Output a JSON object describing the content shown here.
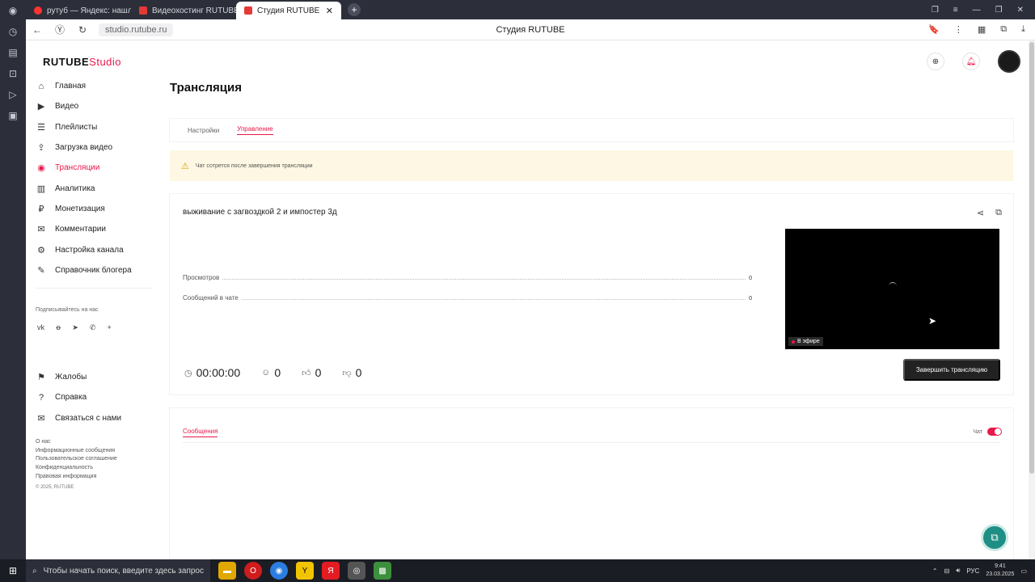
{
  "browser": {
    "tabs": [
      {
        "label": "рутуб — Яндекс: нашлось"
      },
      {
        "label": "Видеохостинг RUTUBE. С"
      },
      {
        "label": "Студия RUTUBE",
        "active": true
      }
    ],
    "url": "studio.rutube.ru",
    "page_title": "Студия RUTUBE"
  },
  "brand": {
    "name": "RUTUBE",
    "suffix": "Studio",
    "accent": "#e8184a"
  },
  "sidebar": {
    "items": [
      {
        "label": "Главная",
        "icon": "home-icon"
      },
      {
        "label": "Видео",
        "icon": "video-icon"
      },
      {
        "label": "Плейлисты",
        "icon": "playlist-icon"
      },
      {
        "label": "Загрузка видео",
        "icon": "upload-icon"
      },
      {
        "label": "Трансляции",
        "icon": "broadcast-icon",
        "active": true
      },
      {
        "label": "Аналитика",
        "icon": "analytics-icon"
      },
      {
        "label": "Монетизация",
        "icon": "monetization-icon"
      },
      {
        "label": "Комментарии",
        "icon": "comments-icon"
      },
      {
        "label": "Настройка канала",
        "icon": "gear-icon"
      },
      {
        "label": "Справочник блогера",
        "icon": "book-icon"
      }
    ],
    "subscribe_label": "Подписывайтесь на нас",
    "secondary": [
      {
        "label": "Жалобы",
        "icon": "flag-icon"
      },
      {
        "label": "Справка",
        "icon": "help-icon"
      },
      {
        "label": "Связаться с нами",
        "icon": "mail-icon"
      }
    ],
    "footer_links": [
      "О нас",
      "Информационные сообщения",
      "Пользовательское соглашение",
      "Конфиденциальность",
      "Правовая информация"
    ],
    "copyright": "© 2025, RUTUBE"
  },
  "main": {
    "title": "Трансляция",
    "tabs": [
      {
        "label": "Настройки"
      },
      {
        "label": "Управление",
        "active": true
      }
    ],
    "warning": "Чат сотрется после завершения трансляции",
    "stream": {
      "title": "выживание с загвоздкой 2 и импостер 3д",
      "stats": [
        {
          "label": "Просмотров",
          "value": "0"
        },
        {
          "label": "Сообщений в чате",
          "value": "0"
        }
      ],
      "live_badge": "В эфире",
      "duration": "00:00:00",
      "viewers": "0",
      "likes": "0",
      "dislikes": "0",
      "end_button": "Завершить трансляцию"
    },
    "chat": {
      "tab": "Сообщения",
      "toggle_label": "Чат",
      "enabled": true
    }
  },
  "taskbar": {
    "search_placeholder": "Чтобы начать поиск, введите здесь запрос",
    "lang": "РУС",
    "time": "9:41",
    "date": "23.03.2025"
  }
}
